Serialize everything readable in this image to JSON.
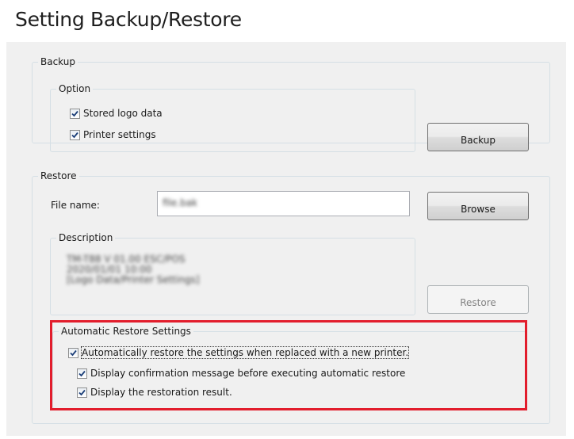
{
  "page": {
    "title": "Setting Backup/Restore"
  },
  "backup": {
    "group_label": "Backup",
    "option_label": "Option",
    "options": [
      {
        "label": "Stored logo data",
        "checked": true
      },
      {
        "label": "Printer settings",
        "checked": true
      }
    ],
    "button_label": "Backup"
  },
  "restore": {
    "group_label": "Restore",
    "file_name_label": "File name:",
    "file_name_value": "file.bak",
    "browse_label": "Browse",
    "description_label": "Description",
    "description_lines": [
      "TM-T88 V 01.00 ESC/POS",
      "2020/01/01 10:00",
      "[Logo Data/Printer Settings]"
    ],
    "restore_button_label": "Restore"
  },
  "auto_restore": {
    "group_label": "Automatic Restore Settings",
    "options": [
      {
        "label": "Automatically restore the settings when replaced with a new printer.",
        "checked": true
      },
      {
        "label": "Display confirmation message before executing automatic restore",
        "checked": true
      },
      {
        "label": "Display the restoration result.",
        "checked": true
      }
    ]
  },
  "colors": {
    "highlight": "#e21d2c",
    "panel_background": "#f0f0f0",
    "group_border": "#d5dfe5"
  }
}
